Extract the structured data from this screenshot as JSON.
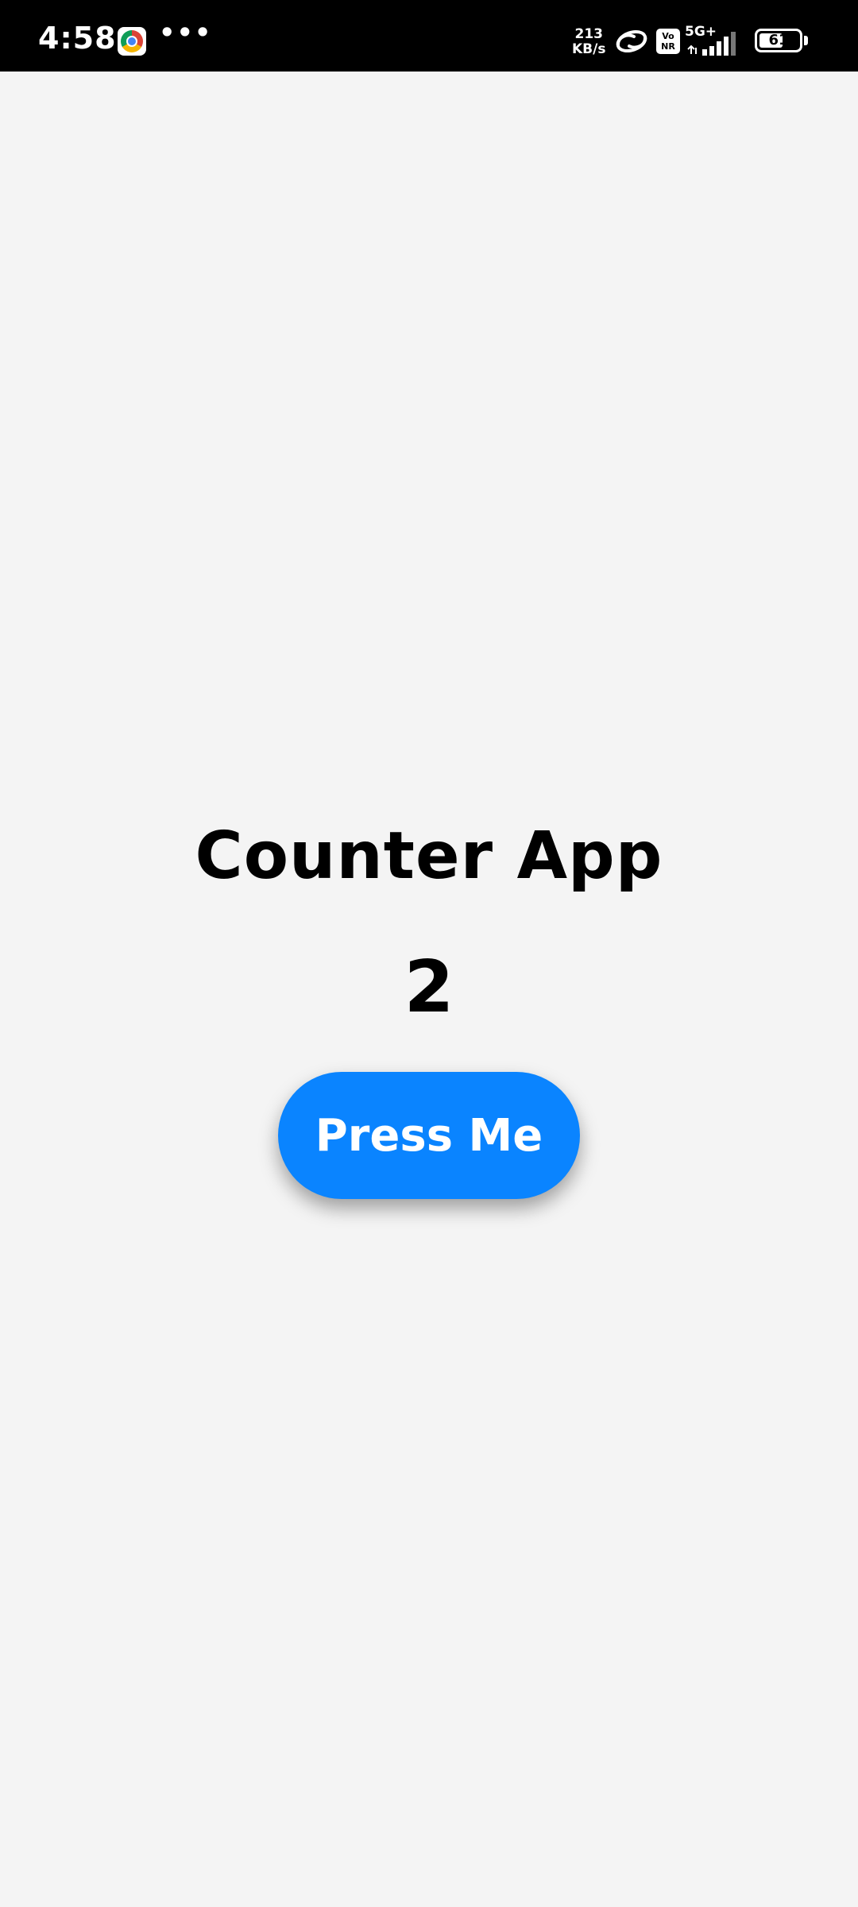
{
  "status_bar": {
    "time": "4:58",
    "more_indicator": "•••",
    "net_speed_value": "213",
    "net_speed_unit": "KB/s",
    "volte_label": "Vo NR",
    "network_type": "5G+",
    "battery_level": "61",
    "battery_fraction": 0.61,
    "icons": [
      "chrome-icon",
      "link-icon",
      "vonr-icon",
      "signal-icon",
      "battery-icon"
    ]
  },
  "app": {
    "title": "Counter App",
    "count": "2",
    "button_label": "Press Me"
  },
  "colors": {
    "background": "#f4f4f4",
    "status_bar": "#000000",
    "button": "#0a84ff",
    "button_text": "#ffffff",
    "text": "#000000"
  }
}
